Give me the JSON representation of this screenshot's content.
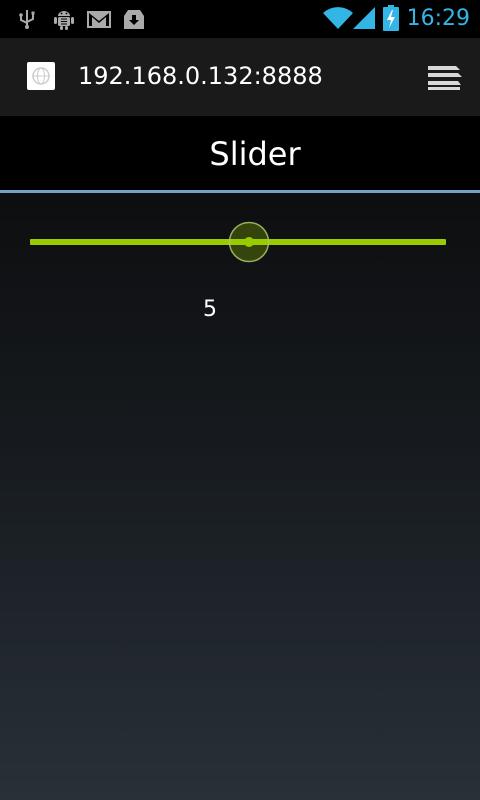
{
  "status_bar": {
    "time": "16:29",
    "icons": [
      "usb-icon",
      "android-debug-icon",
      "gmail-icon",
      "download-icon",
      "wifi-icon",
      "signal-icon",
      "battery-charging-icon"
    ],
    "accent_color": "#33b5e5"
  },
  "browser": {
    "url": "192.168.0.132:8888",
    "favicon": "globe-icon",
    "menu_icon": "tabs-menu-icon"
  },
  "page": {
    "title": "Slider",
    "divider_color": "#6fa3c0"
  },
  "slider": {
    "min": 0,
    "max": 10,
    "value": 5,
    "value_text": "5",
    "track_color": "#99cc00"
  }
}
